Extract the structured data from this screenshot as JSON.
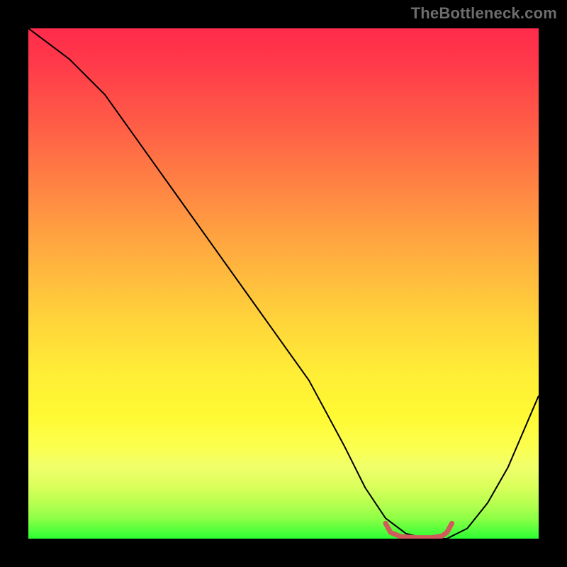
{
  "watermark": "TheBottleneck.com",
  "chart_data": {
    "type": "line",
    "title": "",
    "xlabel": "",
    "ylabel": "",
    "xlim": [
      0,
      100
    ],
    "ylim": [
      0,
      100
    ],
    "grid": false,
    "legend": false,
    "gradient_background": {
      "direction": "vertical",
      "stops": [
        {
          "pos": 0,
          "color": "#ff2b4b"
        },
        {
          "pos": 50,
          "color": "#ffc83c"
        },
        {
          "pos": 80,
          "color": "#fcff45"
        },
        {
          "pos": 100,
          "color": "#2cff34"
        }
      ]
    },
    "series": [
      {
        "name": "bottleneck-curve",
        "color": "#000000",
        "stroke_width": 2,
        "x": [
          0,
          4,
          8,
          15,
          25,
          35,
          45,
          55,
          62,
          66,
          70,
          74,
          78,
          82,
          86,
          90,
          94,
          100
        ],
        "values": [
          100,
          97,
          94,
          87,
          73,
          59,
          45,
          31,
          18,
          10,
          4,
          1,
          0,
          0,
          2,
          7,
          14,
          28
        ]
      },
      {
        "name": "optimal-range-marker",
        "color": "#d15a5a",
        "stroke_width": 7,
        "x": [
          70,
          71,
          73,
          76,
          79,
          81,
          82,
          83
        ],
        "values": [
          3.0,
          1.2,
          0.4,
          0.2,
          0.2,
          0.5,
          1.2,
          3.0
        ]
      }
    ]
  }
}
